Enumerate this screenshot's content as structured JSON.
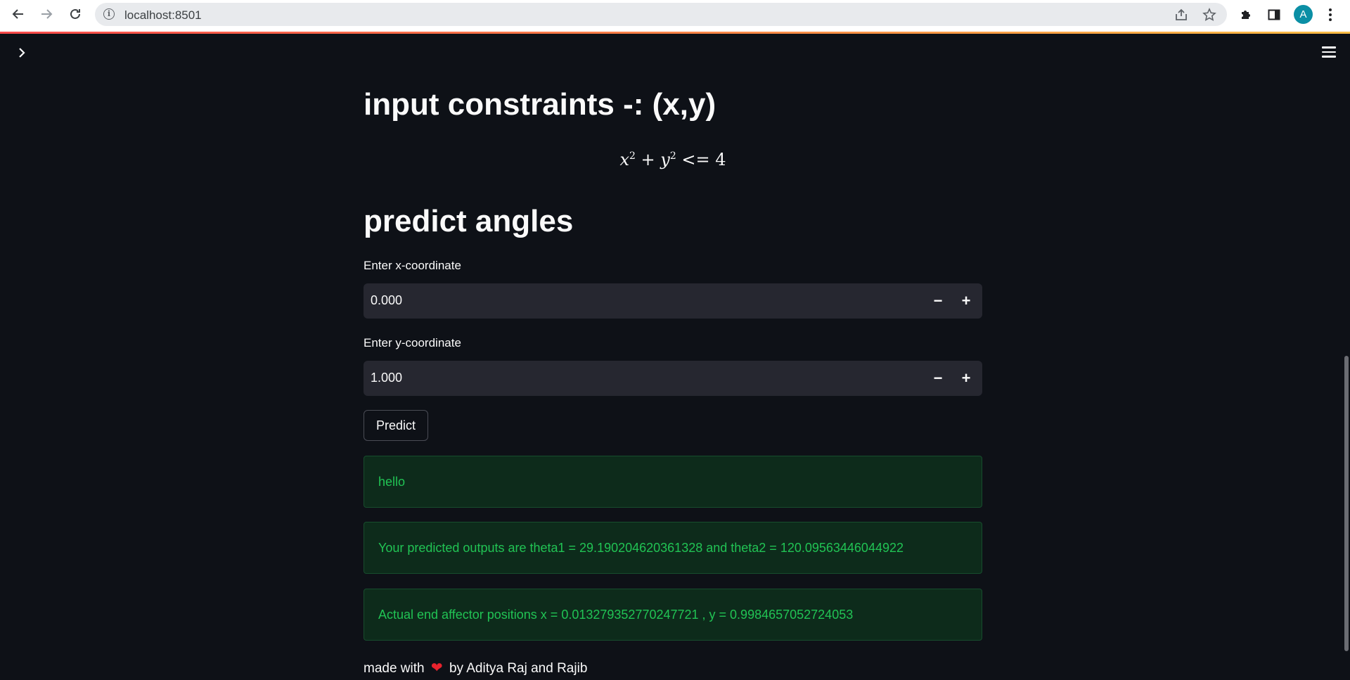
{
  "browser": {
    "url": "localhost:8501",
    "avatar_letter": "A"
  },
  "app": {
    "title": "input constraints -: (x,y)",
    "formula": {
      "x": "x",
      "x_exp": "2",
      "plus": "+",
      "y": "y",
      "y_exp": "2",
      "relation": "<=",
      "rhs": "4"
    },
    "subtitle": "predict angles",
    "x_input": {
      "label": "Enter x-coordinate",
      "value": "0.000",
      "minus": "−",
      "plus": "+"
    },
    "y_input": {
      "label": "Enter y-coordinate",
      "value": "1.000",
      "minus": "−",
      "plus": "+"
    },
    "predict_button": "Predict",
    "alerts": [
      "hello",
      "Your predicted outputs are theta1 = 29.190204620361328 and theta2 = 120.09563446044922",
      "Actual end affector positions x = 0.013279352770247721 , y = 0.9984657052724053"
    ],
    "footer": {
      "before": "made with",
      "heart": "❤",
      "after": "by Aditya Raj and Rajib"
    }
  },
  "colors": {
    "background": "#0e1117",
    "input_bg": "#262730",
    "success_bg": "#0d2b1b",
    "success_text": "#21c354",
    "accent": "#ff4b4b"
  }
}
